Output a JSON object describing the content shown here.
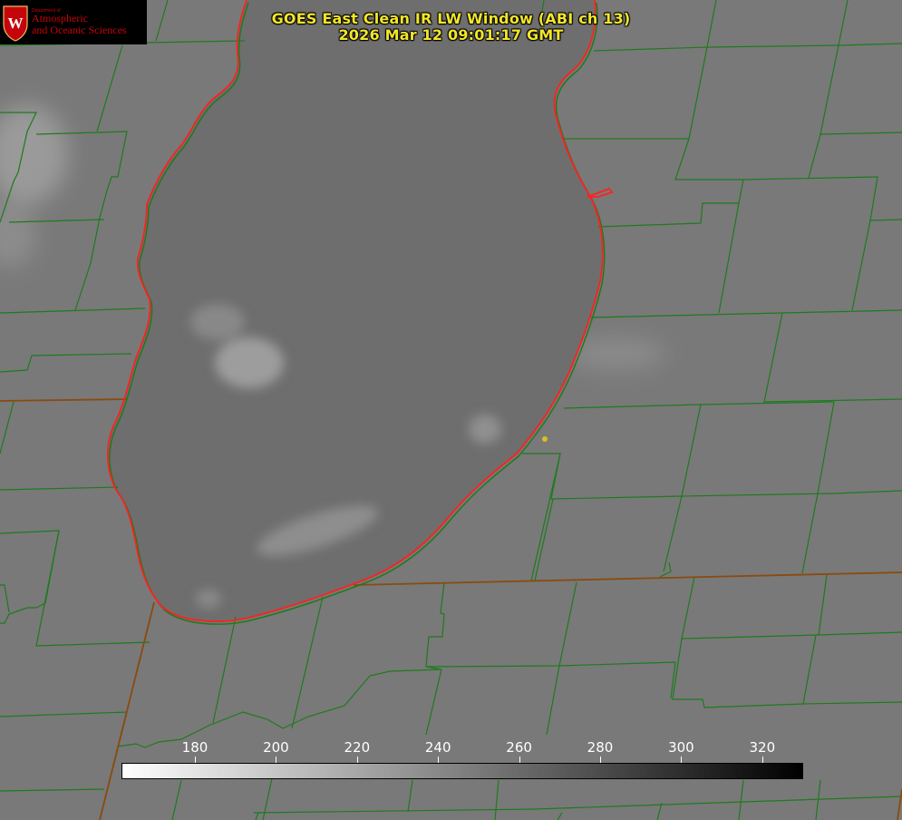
{
  "title": {
    "main": "GOES East Clean IR LW Window (ABI ch 13)",
    "timestamp": "2026 Mar 12 09:01:17 GMT"
  },
  "logo": {
    "department": "Department of",
    "line1": "Atmospheric",
    "line2": "and Oceanic Sciences",
    "seal_letter": "W"
  },
  "colorbar": {
    "ticks": [
      "180",
      "200",
      "220",
      "240",
      "260",
      "280",
      "300",
      "320"
    ],
    "min_color": "#ffffff",
    "max_color": "#000000"
  },
  "colors": {
    "county_lines": "#1e7a1e",
    "state_lines": "#8a4a10",
    "lake_outline": "#ff2020",
    "marker": "#d8c020",
    "title_text": "#f2e62a",
    "logo_red": "#c5050c"
  }
}
